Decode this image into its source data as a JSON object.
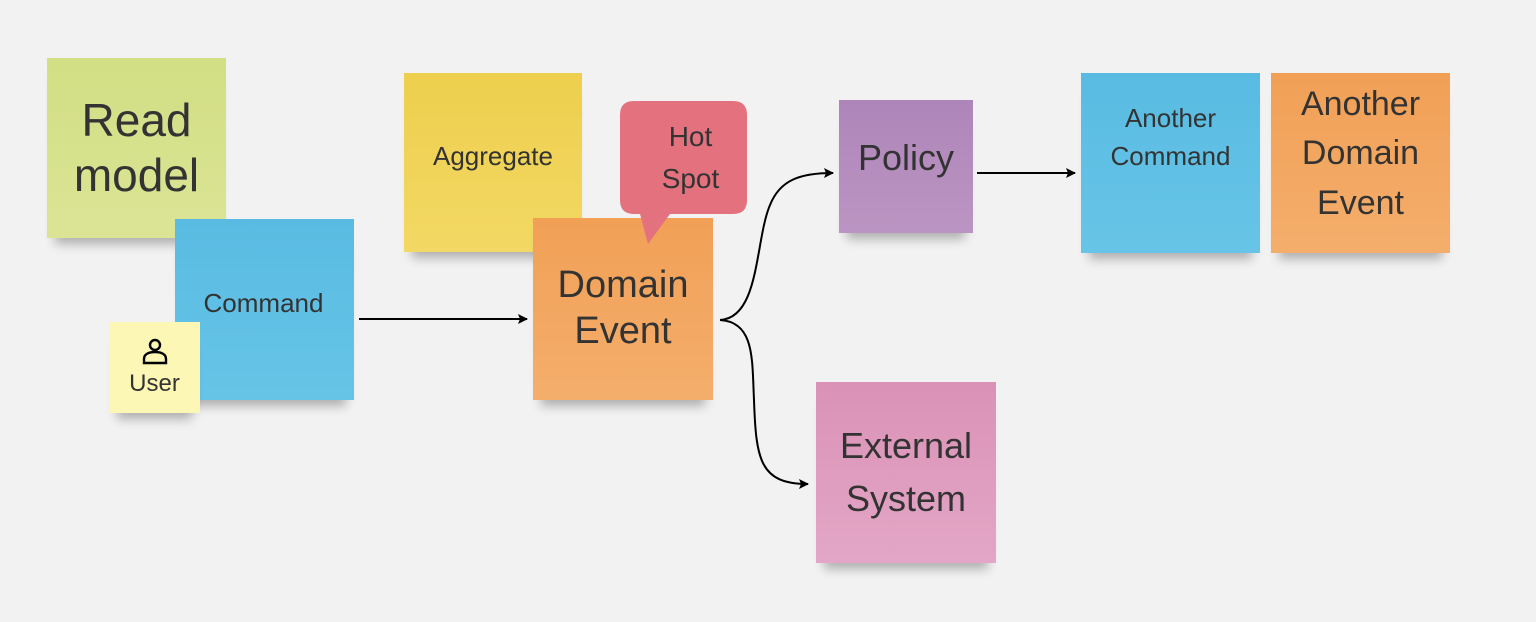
{
  "notes": {
    "read_model": {
      "label": "Read model",
      "color": "#d4e08a"
    },
    "aggregate": {
      "label": "Aggregate",
      "color": "#f0d451"
    },
    "command": {
      "label": "Command",
      "color": "#5cbde4"
    },
    "user": {
      "label": "User",
      "icon": "user-icon",
      "color": "#fdf7b6"
    },
    "domain_event": {
      "label": "Domain Event",
      "color": "#f3a35b"
    },
    "hot_spot": {
      "label": "Hot Spot",
      "color": "#e3717e"
    },
    "policy": {
      "label": "Policy",
      "color": "#b48abd"
    },
    "another_command": {
      "label": "Another Command",
      "color": "#5cbde4"
    },
    "another_domain_event": {
      "label": "Another Domain Event",
      "color": "#f3a35b"
    },
    "external_system": {
      "label": "External System",
      "color": "#df97bd"
    }
  },
  "edges": [
    {
      "from": "Command",
      "to": "Domain Event"
    },
    {
      "from": "Domain Event",
      "to": "Policy"
    },
    {
      "from": "Domain Event",
      "to": "External System"
    },
    {
      "from": "Policy",
      "to": "Another Command"
    }
  ]
}
